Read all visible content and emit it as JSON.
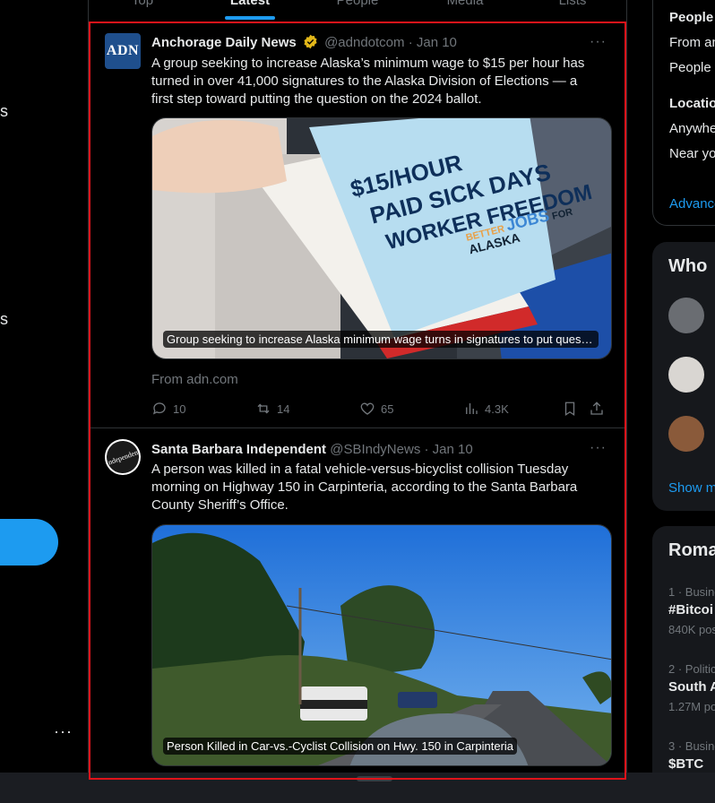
{
  "left_nav": {
    "fragments": [
      "s",
      "s"
    ],
    "more": "···"
  },
  "tabs": [
    {
      "label": "Top"
    },
    {
      "label": "Latest"
    },
    {
      "label": "People"
    },
    {
      "label": "Media"
    },
    {
      "label": "Lists"
    }
  ],
  "tweets": [
    {
      "avatar_text": "ADN",
      "name": "Anchorage Daily News",
      "verified": true,
      "handle": "@adndotcom",
      "date": "· Jan 10",
      "text": "A group seeking to increase Alaska’s minimum wage to $15 per hour has turned in over 41,000 signatures to the Alaska Division of Elections — a first step toward putting the question on the 2024 ballot.",
      "media_caption": "Group seeking to increase Alaska minimum wage turns in signatures to put question on ballot",
      "box_text": [
        "$15/HOUR",
        "PAID SICK DAYS",
        "WORKER FREEDOM"
      ],
      "box_logo": [
        "BETTER",
        "JOBS",
        "FOR",
        "ALASKA"
      ],
      "source": "From adn.com",
      "replies": "10",
      "reposts": "14",
      "likes": "65",
      "views": "4.3K"
    },
    {
      "avatar_text": "Independent",
      "name": "Santa Barbara Independent",
      "verified": false,
      "handle": "@SBIndyNews",
      "date": "· Jan 10",
      "text": "A person was killed in a fatal vehicle-versus-bicyclist collision Tuesday morning on Highway 150 in Carpinteria, according to the Santa Barbara County Sheriff’s Office.",
      "media_caption": "Person Killed in Car-vs.-Cyclist Collision on Hwy. 150 in Carpinteria"
    }
  ],
  "right": {
    "search_filters": {
      "people_title": "People",
      "people_opt1": "From an",
      "people_opt2": "People y",
      "location_title": "Location",
      "location_opt1": "Anywhe",
      "location_opt2": "Near yo",
      "advanced": "Advance"
    },
    "who_to_follow": {
      "title": "Who",
      "show_more": "Show m"
    },
    "trends": {
      "title": "Roma",
      "items": [
        {
          "meta": "1 · Busine",
          "topic": "#Bitcoi",
          "count": "840K pos"
        },
        {
          "meta": "2 · Politic",
          "topic": "South A",
          "count": "1.27M po"
        },
        {
          "meta": "3 · Busine",
          "topic": "$BTC",
          "count": ""
        }
      ]
    }
  },
  "colors": {
    "accent": "#1d9bf0",
    "highlight_frame": "#e0131a",
    "verified": "#e2b719"
  }
}
